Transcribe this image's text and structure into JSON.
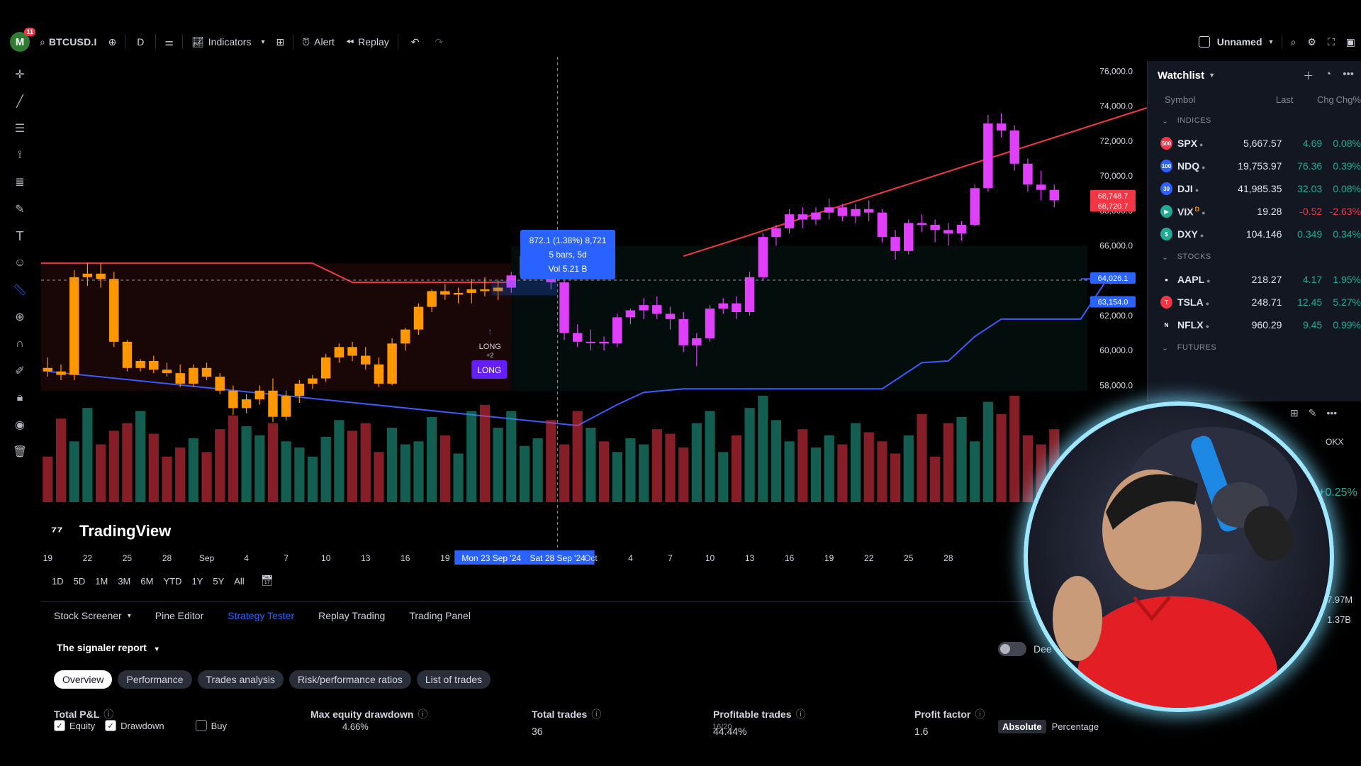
{
  "toolbar": {
    "notifications": "11",
    "avatar_letter": "M",
    "symbol": "BTCUSD.I",
    "interval": "D",
    "indicators": "Indicators",
    "alert": "Alert",
    "replay": "Replay",
    "layout_name": "Unnamed"
  },
  "watchlist": {
    "title": "Watchlist",
    "columns": [
      "Symbol",
      "Last",
      "Chg",
      "Chg%"
    ],
    "groups": [
      {
        "name": "INDICES",
        "rows": [
          {
            "icon": "500",
            "icon_color": "#f23645",
            "symbol": "SPX",
            "last": "5,667.57",
            "chg": "4.69",
            "chgp": "0.08%",
            "dir": "pos"
          },
          {
            "icon": "100",
            "icon_color": "#2962ff",
            "symbol": "NDQ",
            "last": "19,753.97",
            "chg": "76.36",
            "chgp": "0.39%",
            "dir": "pos"
          },
          {
            "icon": "30",
            "icon_color": "#2962ff",
            "symbol": "DJI",
            "last": "41,985.35",
            "chg": "32.03",
            "chgp": "0.08%",
            "dir": "pos"
          },
          {
            "icon": "▶",
            "icon_color": "#22ab94",
            "symbol": "VIX",
            "sup": "D",
            "last": "19.28",
            "chg": "-0.52",
            "chgp": "-2.63%",
            "dir": "neg"
          },
          {
            "icon": "$",
            "icon_color": "#22ab94",
            "symbol": "DXY",
            "last": "104.146",
            "chg": "0.349",
            "chgp": "0.34%",
            "dir": "pos"
          }
        ]
      },
      {
        "name": "STOCKS",
        "rows": [
          {
            "icon": "●",
            "icon_color": "#131722",
            "symbol": "AAPL",
            "last": "218.27",
            "chg": "4.17",
            "chgp": "1.95%",
            "dir": "pos"
          },
          {
            "icon": "T",
            "icon_color": "#f23645",
            "symbol": "TSLA",
            "last": "248.71",
            "chg": "12.45",
            "chgp": "5.27%",
            "dir": "pos"
          },
          {
            "icon": "N",
            "icon_color": "#131722",
            "symbol": "NFLX",
            "last": "960.29",
            "chg": "9.45",
            "chgp": "0.99%",
            "dir": "pos"
          }
        ]
      },
      {
        "name": "FUTURES",
        "rows": []
      }
    ]
  },
  "range_buttons": [
    "1D",
    "5D",
    "1M",
    "3M",
    "6M",
    "YTD",
    "1Y",
    "5Y",
    "All"
  ],
  "bottom": {
    "tabs": [
      "Stock Screener",
      "Pine Editor",
      "Strategy Tester",
      "Replay Trading",
      "Trading Panel"
    ],
    "active_tab": "Strategy Tester",
    "report_title": "The signaler report",
    "subtabs": [
      "Overview",
      "Performance",
      "Trades analysis",
      "Risk/performance ratios",
      "List of trades"
    ],
    "metrics": [
      {
        "label": "Total P&L",
        "value": ""
      },
      {
        "label": "Max equity drawdown",
        "value": ""
      },
      {
        "label": "Total trades",
        "value": "36"
      },
      {
        "label": "Profitable trades",
        "value": "44.44%"
      },
      {
        "label": "Profit factor",
        "value": "1.6"
      }
    ],
    "checks": [
      {
        "label": "Equity",
        "on": true
      },
      {
        "label": "Drawdown",
        "on": true
      },
      {
        "label": "Buy",
        "on": false
      }
    ],
    "drawdown_pct": "4.66%",
    "trade_ratio": "16/20",
    "toggle_label": "Dee",
    "absolute": "Absolute",
    "percentage": "Percentage"
  },
  "webcam": {
    "exchange": "OKX",
    "change": "+0.25%",
    "vol1": "7.97M",
    "vol2": "1.37B"
  },
  "chart_data": {
    "type": "candlestick",
    "watermark": "TradingView",
    "x_ticks": [
      "19",
      "22",
      "25",
      "28",
      "Sep",
      "4",
      "7",
      "10",
      "13",
      "16",
      "19",
      "Mon 23 Sep '24",
      "Sat 28 Sep '24",
      "Oct",
      "4",
      "7",
      "10",
      "13",
      "16",
      "19",
      "22",
      "25",
      "28"
    ],
    "y_ticks": [
      "76,000.0",
      "74,000.0",
      "72,000.0",
      "70,000.0",
      "68,000.0",
      "66,000.0",
      "64,000.0",
      "62,000.0",
      "60,000.0",
      "58,000.0"
    ],
    "ylim": [
      57000,
      76500
    ],
    "price_labels": [
      "68,748.7",
      "68,720.7",
      "64,026.1",
      "63,154.0"
    ],
    "measure_tooltip": {
      "line1": "872.1 (1.38%) 8,721",
      "line2": "5 bars, 5d",
      "line3": "Vol 5.21 B"
    },
    "signal": {
      "label_small": "LONG",
      "sub": "+2",
      "label_big": "LONG"
    },
    "candles": [
      [
        59000,
        59600,
        58500,
        58800
      ],
      [
        58800,
        59200,
        58300,
        58600
      ],
      [
        58600,
        64600,
        58300,
        64200
      ],
      [
        64200,
        65000,
        63700,
        64400
      ],
      [
        64400,
        65000,
        63600,
        64100
      ],
      [
        64100,
        64500,
        60200,
        60500
      ],
      [
        60500,
        60600,
        58800,
        59000
      ],
      [
        59000,
        59500,
        58800,
        59400
      ],
      [
        59400,
        59700,
        58700,
        58900
      ],
      [
        58900,
        59300,
        58500,
        58700
      ],
      [
        58700,
        59200,
        57900,
        58100
      ],
      [
        58100,
        59200,
        57900,
        59000
      ],
      [
        59000,
        59300,
        58300,
        58500
      ],
      [
        58500,
        58700,
        57500,
        57700
      ],
      [
        57700,
        58000,
        56300,
        56700
      ],
      [
        56700,
        57500,
        56400,
        57200
      ],
      [
        57200,
        58000,
        56900,
        57700
      ],
      [
        57700,
        58400,
        55900,
        56200
      ],
      [
        56200,
        57700,
        56000,
        57400
      ],
      [
        57400,
        58300,
        57000,
        58100
      ],
      [
        58100,
        58600,
        57800,
        58400
      ],
      [
        58400,
        59800,
        58200,
        59600
      ],
      [
        59600,
        60400,
        59300,
        60200
      ],
      [
        60200,
        60500,
        59400,
        59700
      ],
      [
        59700,
        60200,
        58900,
        59200
      ],
      [
        59200,
        59600,
        57900,
        58100
      ],
      [
        58100,
        60700,
        58000,
        60400
      ],
      [
        60400,
        61300,
        60000,
        61200
      ],
      [
        61200,
        62700,
        60900,
        62500
      ],
      [
        62500,
        63500,
        62200,
        63400
      ],
      [
        63400,
        63800,
        62900,
        63200
      ],
      [
        63200,
        63600,
        62700,
        63300
      ],
      [
        63300,
        64100,
        62700,
        63500
      ],
      [
        63500,
        64200,
        63100,
        63400
      ],
      [
        63400,
        64000,
        62900,
        63600
      ],
      [
        63600,
        64500,
        63300,
        64300
      ],
      [
        64300,
        65600,
        64000,
        65400
      ],
      [
        65400,
        66200,
        65100,
        65600
      ],
      [
        65600,
        65900,
        63500,
        63900
      ],
      [
        63900,
        64000,
        60600,
        61000
      ],
      [
        61000,
        61500,
        60200,
        60500
      ],
      [
        60500,
        61200,
        60000,
        60500
      ],
      [
        60500,
        60800,
        60000,
        60400
      ],
      [
        60400,
        62100,
        60200,
        61900
      ],
      [
        61900,
        62400,
        61500,
        62300
      ],
      [
        62300,
        63000,
        61800,
        62600
      ],
      [
        62600,
        63100,
        61800,
        62100
      ],
      [
        62100,
        62500,
        61200,
        61800
      ],
      [
        61800,
        62200,
        59900,
        60300
      ],
      [
        60300,
        61000,
        59100,
        60700
      ],
      [
        60700,
        62600,
        60500,
        62400
      ],
      [
        62400,
        63000,
        62100,
        62700
      ],
      [
        62700,
        63100,
        61800,
        62200
      ],
      [
        62200,
        64500,
        62000,
        64200
      ],
      [
        64200,
        66700,
        64000,
        66500
      ],
      [
        66500,
        67200,
        66000,
        67000
      ],
      [
        67000,
        68100,
        66700,
        67800
      ],
      [
        67800,
        68200,
        67000,
        67500
      ],
      [
        67500,
        68200,
        67200,
        67900
      ],
      [
        67900,
        68700,
        67500,
        68200
      ],
      [
        68200,
        68400,
        67400,
        67700
      ],
      [
        67700,
        68400,
        67300,
        68100
      ],
      [
        68100,
        68600,
        67400,
        67900
      ],
      [
        67900,
        68100,
        66200,
        66500
      ],
      [
        66500,
        66900,
        65200,
        65700
      ],
      [
        65700,
        67500,
        65500,
        67300
      ],
      [
        67300,
        67800,
        66800,
        67200
      ],
      [
        67200,
        67500,
        66200,
        66900
      ],
      [
        66900,
        67300,
        66000,
        66700
      ],
      [
        66700,
        67400,
        66300,
        67200
      ],
      [
        67200,
        69500,
        67100,
        69300
      ],
      [
        69300,
        73500,
        69100,
        73000
      ],
      [
        73000,
        73600,
        72200,
        72600
      ],
      [
        72600,
        72900,
        70300,
        70700
      ],
      [
        70700,
        71000,
        69100,
        69500
      ],
      [
        69500,
        70300,
        68600,
        69200
      ],
      [
        69200,
        69500,
        68200,
        68600
      ]
    ],
    "volume": [
      30,
      55,
      40,
      62,
      38,
      47,
      52,
      60,
      45,
      30,
      36,
      42,
      33,
      48,
      57,
      50,
      44,
      52,
      40,
      36,
      30,
      43,
      54,
      47,
      52,
      33,
      49,
      38,
      40,
      56,
      44,
      32,
      60,
      64,
      49,
      60,
      37,
      42,
      54,
      38,
      60,
      49,
      40,
      33,
      42,
      38,
      48,
      45,
      36,
      52,
      60,
      33,
      44,
      62,
      70,
      54,
      40,
      48,
      36,
      44,
      38,
      52,
      46,
      40,
      32,
      44,
      58,
      30,
      52,
      56,
      40,
      66,
      58,
      70,
      44,
      38,
      48
    ],
    "upper_line_start": [
      0,
      65000
    ],
    "resistance_line": [
      [
        48,
        65400
      ],
      [
        83,
        73900
      ]
    ],
    "support_line": [
      [
        0,
        58800
      ],
      [
        40,
        55700
      ]
    ]
  }
}
